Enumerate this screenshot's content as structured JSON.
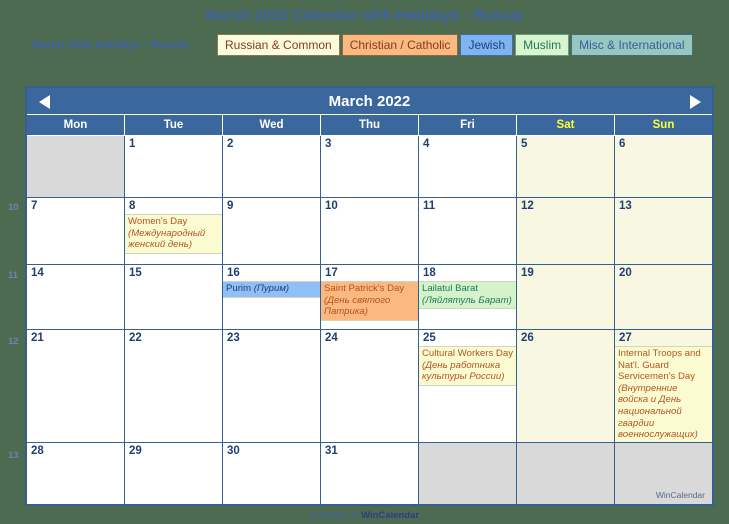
{
  "page": {
    "title": "March 2022 Calendar with Holidays - Russia",
    "subtitle": "March 2022 Holidays - Russia:",
    "watermark": "WinCalendar",
    "footer_prefix": "Courtesy of ",
    "footer_brand": "WinCalendar"
  },
  "legend": {
    "chips": [
      {
        "label": "Russian & Common",
        "bg": "#fbfbdd",
        "fg": "#8a3a20"
      },
      {
        "label": "Christian / Catholic",
        "bg": "#f9b980",
        "fg": "#8a3a20"
      },
      {
        "label": "Jewish",
        "bg": "#7fb4f2",
        "fg": "#1d3f7a"
      },
      {
        "label": "Muslim",
        "bg": "#d8f5d0",
        "fg": "#1f7a5a"
      },
      {
        "label": "Misc & International",
        "bg": "#95c8c0",
        "fg": "#3f5a9a"
      }
    ]
  },
  "calendar": {
    "month_title": "March 2022",
    "prev_label": "previous month",
    "next_label": "next month",
    "weekdays": [
      {
        "label": "Mon",
        "weekend": false
      },
      {
        "label": "Tue",
        "weekend": false
      },
      {
        "label": "Wed",
        "weekend": false
      },
      {
        "label": "Thu",
        "weekend": false
      },
      {
        "label": "Fri",
        "weekend": false
      },
      {
        "label": "Sat",
        "weekend": true
      },
      {
        "label": "Sun",
        "weekend": true
      }
    ],
    "week_numbers": [
      "",
      "10",
      "11",
      "12",
      "13"
    ],
    "weeks": [
      {
        "num": "",
        "days": [
          {
            "n": "",
            "blank": true
          },
          {
            "n": "1"
          },
          {
            "n": "2"
          },
          {
            "n": "3"
          },
          {
            "n": "4"
          },
          {
            "n": "5",
            "weekend": true
          },
          {
            "n": "6",
            "weekend": true
          }
        ]
      },
      {
        "num": "10",
        "days": [
          {
            "n": "7"
          },
          {
            "n": "8",
            "events": [
              {
                "cat": "russian",
                "en": "Women's Day",
                "ru": "(Международный женский день)"
              }
            ]
          },
          {
            "n": "9"
          },
          {
            "n": "10"
          },
          {
            "n": "11"
          },
          {
            "n": "12",
            "weekend": true
          },
          {
            "n": "13",
            "weekend": true
          }
        ]
      },
      {
        "num": "11",
        "days": [
          {
            "n": "14"
          },
          {
            "n": "15"
          },
          {
            "n": "16",
            "events": [
              {
                "cat": "jewish",
                "en": "Purim ",
                "ru": "(Пурим)",
                "inline": true
              }
            ]
          },
          {
            "n": "17",
            "events": [
              {
                "cat": "christian",
                "en": "Saint Patrick's Day",
                "ru": "(День святого Патрика)"
              }
            ]
          },
          {
            "n": "18",
            "events": [
              {
                "cat": "muslim",
                "en": "Lailatul Barat",
                "ru": "(Ляйлятуль Барат)"
              }
            ]
          },
          {
            "n": "19",
            "weekend": true
          },
          {
            "n": "20",
            "weekend": true
          }
        ]
      },
      {
        "num": "12",
        "days": [
          {
            "n": "21"
          },
          {
            "n": "22"
          },
          {
            "n": "23"
          },
          {
            "n": "24"
          },
          {
            "n": "25",
            "events": [
              {
                "cat": "russian",
                "en": "Cultural Workers Day",
                "ru": "(День работника культуры России)"
              }
            ]
          },
          {
            "n": "26",
            "weekend": true
          },
          {
            "n": "27",
            "weekend": true,
            "events": [
              {
                "cat": "russian",
                "en": "Internal Troops and Nat'l. Guard Servicemen's Day",
                "ru": "(Внутренние войска и День национальной гвардии военнослужащих)"
              }
            ]
          }
        ]
      },
      {
        "num": "13",
        "days": [
          {
            "n": "28"
          },
          {
            "n": "29"
          },
          {
            "n": "30"
          },
          {
            "n": "31"
          },
          {
            "n": "",
            "blank": true
          },
          {
            "n": "",
            "blank": true
          },
          {
            "n": "",
            "blank": true
          }
        ]
      }
    ]
  }
}
